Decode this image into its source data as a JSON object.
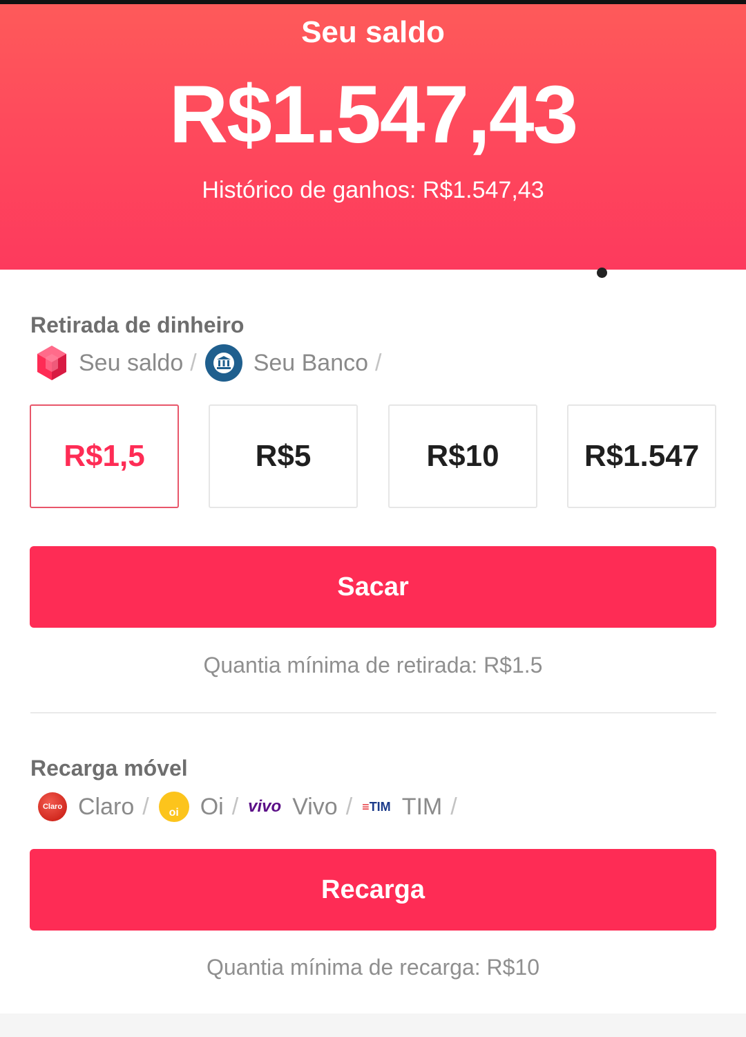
{
  "header": {
    "title": "Seu saldo",
    "balance": "R$1.547,43",
    "history": "Histórico de ganhos: R$1.547,43"
  },
  "withdraw": {
    "title": "Retirada de dinheiro",
    "methods": [
      "Seu saldo",
      "Seu Banco"
    ],
    "separator": "/",
    "amounts": [
      "R$1,5",
      "R$5",
      "R$10",
      "R$1.547"
    ],
    "selected_amount": "R$1,5",
    "button_label": "Sacar",
    "hint": "Quantia mínima de retirada: R$1.5"
  },
  "recharge": {
    "title": "Recarga móvel",
    "carriers": [
      "Claro",
      "Oi",
      "Vivo",
      "TIM"
    ],
    "logo_text": {
      "claro": "Claro",
      "oi": "oi",
      "vivo": "vivo",
      "tim_mark": "≡",
      "tim": "TIM"
    },
    "button_label": "Recarga",
    "hint": "Quantia mínima de recarga: R$10"
  },
  "icons": {
    "balance_method": "gem-icon",
    "bank_method": "bank-icon",
    "carriers": [
      "claro-logo",
      "oi-logo",
      "vivo-logo",
      "tim-logo"
    ]
  },
  "colors": {
    "accent": "#fe2c55",
    "header_top": "#fe5a5a",
    "header_bottom": "#fd3a5d",
    "bank_icon": "#1f5f8e"
  }
}
